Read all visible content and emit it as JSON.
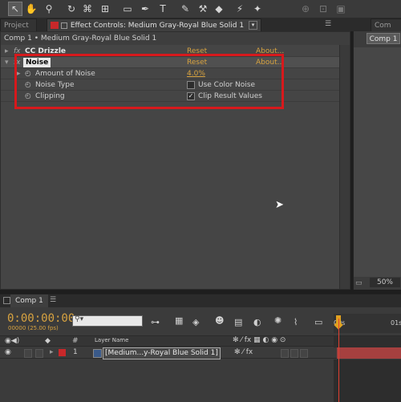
{
  "toolbar": {
    "icons": [
      "selection-tool",
      "hand-tool",
      "zoom-tool",
      "rotate-tool",
      "camera-tool",
      "pan-behind-tool",
      "mask-tool",
      "pen-tool",
      "text-tool",
      "brush-tool",
      "clone-stamp-tool",
      "eraser-tool",
      "roto-brush-tool",
      "puppet-tool"
    ]
  },
  "tabs": {
    "project": "Project",
    "effect_controls": "Effect Controls: Medium Gray-Royal Blue Solid 1",
    "comp_right": "Com"
  },
  "effect_panel": {
    "header": "Comp 1 • Medium Gray-Royal Blue Solid 1",
    "effects": [
      {
        "name": "CC Drizzle",
        "reset": "Reset",
        "about": "About..."
      },
      {
        "name": "Noise",
        "reset": "Reset",
        "about": "About..."
      }
    ],
    "properties": [
      {
        "label": "Amount of Noise",
        "value": "4.0%"
      },
      {
        "label": "Noise Type",
        "value": "Use Color Noise",
        "checked": false
      },
      {
        "label": "Clipping",
        "value": "Clip Result Values",
        "checked": true
      }
    ],
    "fx_label": "fx"
  },
  "right_panel": {
    "comp_button": "Comp 1",
    "zoom": "50%"
  },
  "timeline": {
    "tab_label": "Comp 1",
    "timecode": "0:00:00:00",
    "frame_info": "00000 (25.00 fps)",
    "search_placeholder": "",
    "columns": {
      "layer_name": "Layer Name",
      "number": "#"
    },
    "ruler": {
      "start": "00s",
      "next": "01s"
    },
    "layers": [
      {
        "number": "1",
        "name": "[Medium...y-Royal Blue Solid 1]",
        "color": "#c8282a"
      }
    ]
  },
  "colors": {
    "accent_orange": "#d8a340",
    "highlight_red": "#d7191c",
    "playhead": "#e0a020"
  }
}
